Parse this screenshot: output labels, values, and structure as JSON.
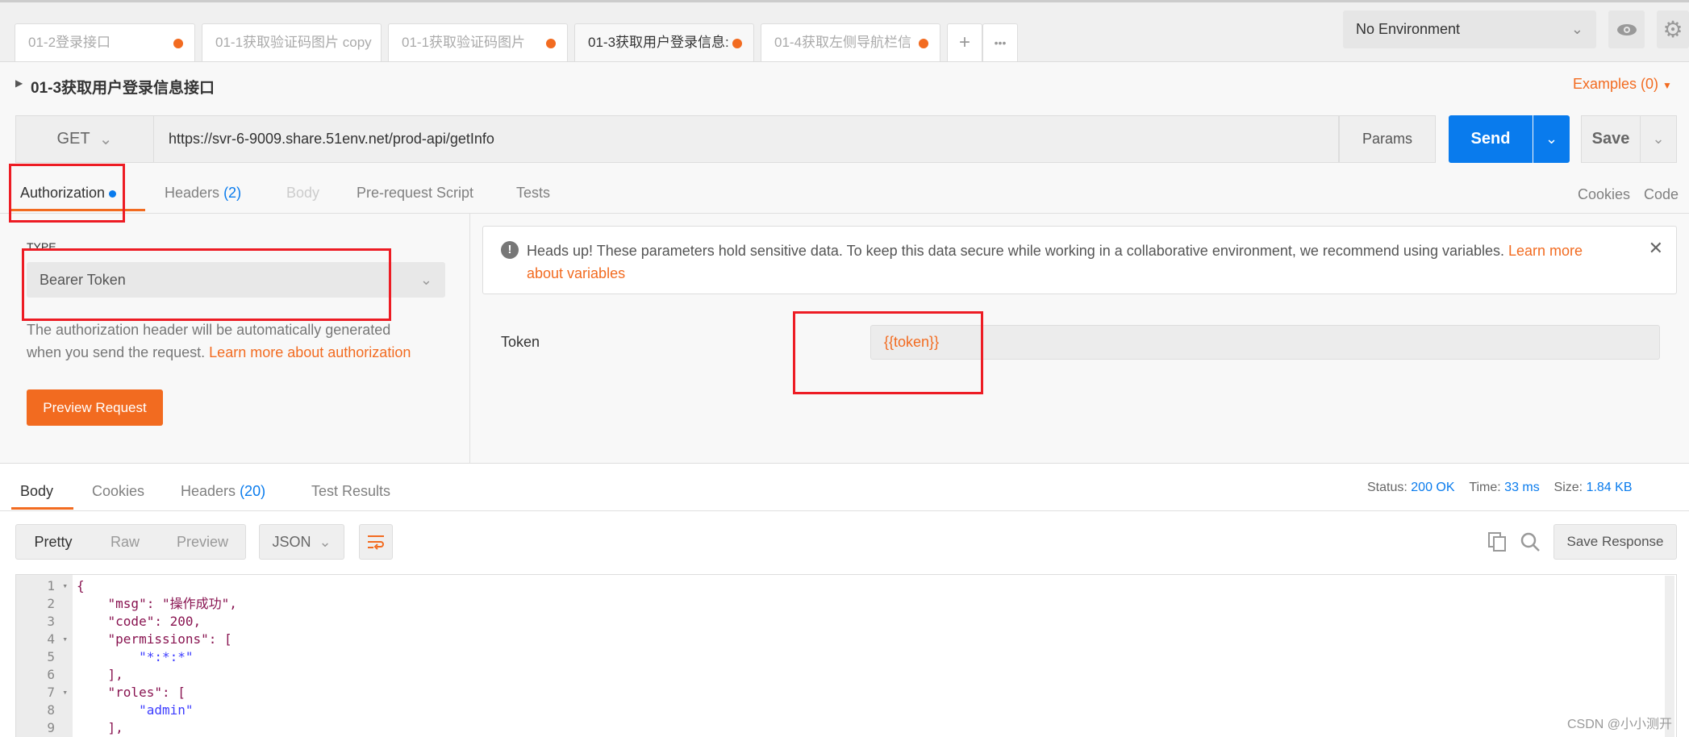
{
  "tabs": [
    {
      "label": "01-2登录接口",
      "unsaved": true
    },
    {
      "label": "01-1获取验证码图片 copy",
      "unsaved": false
    },
    {
      "label": "01-1获取验证码图片",
      "unsaved": true
    },
    {
      "label": "01-3获取用户登录信息:",
      "unsaved": true,
      "active": true
    },
    {
      "label": "01-4获取左侧导航栏信",
      "unsaved": true
    }
  ],
  "tab_actions": {
    "add": "+",
    "more": "•••"
  },
  "environment": {
    "selected": "No Environment"
  },
  "request": {
    "name": "01-3获取用户登录信息接口",
    "examples": "Examples (0)",
    "method": "GET",
    "url": "https://svr-6-9009.share.51env.net/prod-api/getInfo",
    "params": "Params",
    "send": "Send",
    "save": "Save"
  },
  "req_tabs": {
    "authorization": "Authorization",
    "headers": "Headers",
    "headers_count": "(2)",
    "body": "Body",
    "prerequest": "Pre-request Script",
    "tests": "Tests",
    "cookies": "Cookies",
    "code": "Code"
  },
  "auth": {
    "type_label": "TYPE",
    "type_value": "Bearer Token",
    "desc1": "The authorization header will be automatically generated",
    "desc2": "when you send the request.",
    "learn_more": "Learn more about authorization",
    "preview": "Preview Request",
    "alert": "Heads up! These parameters hold sensitive data. To keep this data secure while working in a collaborative environment, we recommend using variables.",
    "alert_link1": "Learn more",
    "alert_link2": "about variables",
    "token_label": "Token",
    "token_value": "{{token}}"
  },
  "response": {
    "body": "Body",
    "cookies": "Cookies",
    "headers": "Headers",
    "headers_count": "(20)",
    "test_results": "Test Results",
    "status_label": "Status:",
    "status": "200 OK",
    "time_label": "Time:",
    "time": "33 ms",
    "size_label": "Size:",
    "size": "1.84 KB",
    "pretty": "Pretty",
    "raw": "Raw",
    "preview": "Preview",
    "format": "JSON",
    "save_response": "Save Response"
  },
  "code_lines": [
    "{",
    "    \"msg\": \"操作成功\",",
    "    \"code\": 200,",
    "    \"permissions\": [",
    "        \"*:*:*\"",
    "    ],",
    "    \"roles\": [",
    "        \"admin\"",
    "    ],"
  ],
  "watermark": "CSDN @小小测开",
  "colors": {
    "accent": "#f26b20",
    "send": "#097bed",
    "highlight": "#ed1c24"
  }
}
